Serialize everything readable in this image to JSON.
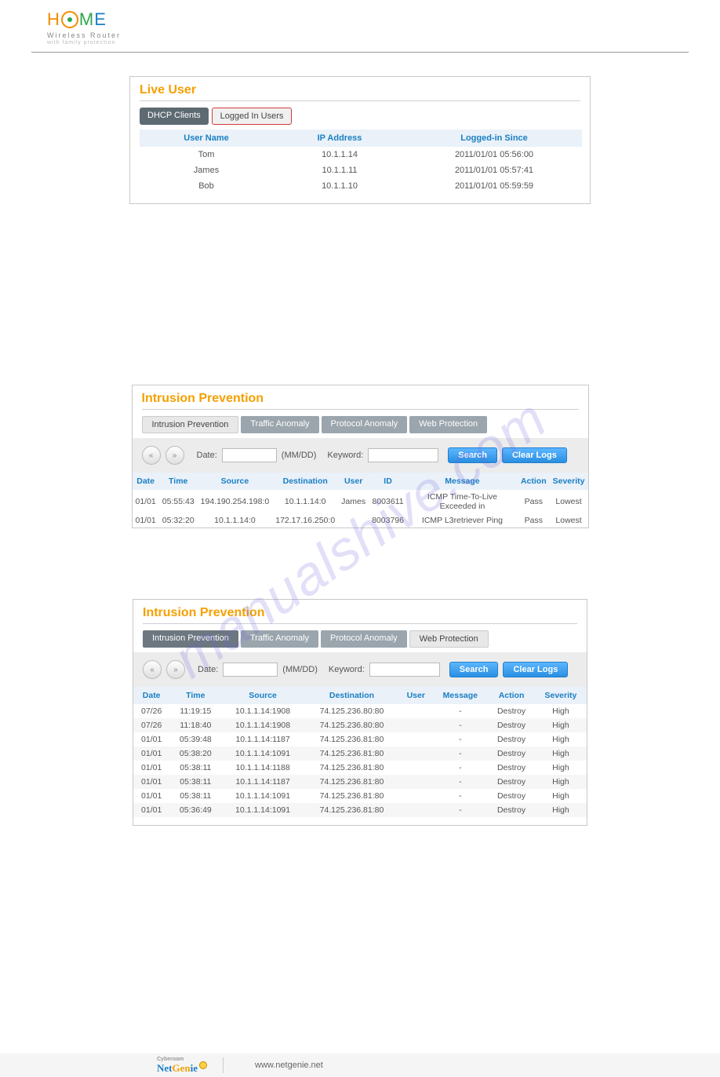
{
  "watermark": "manualshive.com",
  "logo": {
    "sub1": "Wireless  Router",
    "sub2": "with family protection"
  },
  "panel1": {
    "title": "Live User",
    "tabs": [
      "DHCP Clients",
      "Logged In Users"
    ],
    "headers": [
      "User Name",
      "IP Address",
      "Logged-in Since"
    ],
    "rows": [
      {
        "user": "Tom",
        "ip": "10.1.1.14",
        "since": "2011/01/01 05:56:00"
      },
      {
        "user": "James",
        "ip": "10.1.1.11",
        "since": "2011/01/01 05:57:41"
      },
      {
        "user": "Bob",
        "ip": "10.1.1.10",
        "since": "2011/01/01 05:59:59"
      }
    ]
  },
  "panel2": {
    "title": "Intrusion Prevention",
    "tabs": [
      "Intrusion Prevention",
      "Traffic Anomaly",
      "Protocol Anomaly",
      "Web Protection"
    ],
    "date_label": "Date:",
    "date_hint": "(MM/DD)",
    "keyword_label": "Keyword:",
    "search_btn": "Search",
    "clear_btn": "Clear Logs",
    "headers": [
      "Date",
      "Time",
      "Source",
      "Destination",
      "User",
      "ID",
      "Message",
      "Action",
      "Severity"
    ],
    "rows": [
      {
        "date": "01/01",
        "time": "05:55:43",
        "src": "194.190.254.198:0",
        "dst": "10.1.1.14:0",
        "user": "James",
        "id": "8003611",
        "msg": "ICMP Time-To-Live Exceeded in",
        "act": "Pass",
        "sev": "Lowest"
      },
      {
        "date": "01/01",
        "time": "05:32:20",
        "src": "10.1.1.14:0",
        "dst": "172.17.16.250:0",
        "user": "",
        "id": "8003796",
        "msg": "ICMP L3retriever Ping",
        "act": "Pass",
        "sev": "Lowest"
      }
    ]
  },
  "panel3": {
    "title": "Intrusion Prevention",
    "tabs": [
      "Intrusion Prevention",
      "Traffic Anomaly",
      "Protocol Anomaly",
      "Web Protection"
    ],
    "date_label": "Date:",
    "date_hint": "(MM/DD)",
    "keyword_label": "Keyword:",
    "search_btn": "Search",
    "clear_btn": "Clear Logs",
    "headers": [
      "Date",
      "Time",
      "Source",
      "Destination",
      "User",
      "Message",
      "Action",
      "Severity"
    ],
    "rows": [
      {
        "date": "07/26",
        "time": "11:19:15",
        "src": "10.1.1.14:1908",
        "dst": "74.125.236.80:80",
        "user": "",
        "msg": "-",
        "act": "Destroy",
        "sev": "High"
      },
      {
        "date": "07/26",
        "time": "11:18:40",
        "src": "10.1.1.14:1908",
        "dst": "74.125.236.80:80",
        "user": "",
        "msg": "-",
        "act": "Destroy",
        "sev": "High"
      },
      {
        "date": "01/01",
        "time": "05:39:48",
        "src": "10.1.1.14:1187",
        "dst": "74.125.236.81:80",
        "user": "",
        "msg": "-",
        "act": "Destroy",
        "sev": "High"
      },
      {
        "date": "01/01",
        "time": "05:38:20",
        "src": "10.1.1.14:1091",
        "dst": "74.125.236.81:80",
        "user": "",
        "msg": "-",
        "act": "Destroy",
        "sev": "High"
      },
      {
        "date": "01/01",
        "time": "05:38:11",
        "src": "10.1.1.14:1188",
        "dst": "74.125.236.81:80",
        "user": "",
        "msg": "-",
        "act": "Destroy",
        "sev": "High"
      },
      {
        "date": "01/01",
        "time": "05:38:11",
        "src": "10.1.1.14:1187",
        "dst": "74.125.236.81:80",
        "user": "",
        "msg": "-",
        "act": "Destroy",
        "sev": "High"
      },
      {
        "date": "01/01",
        "time": "05:38:11",
        "src": "10.1.1.14:1091",
        "dst": "74.125.236.81:80",
        "user": "",
        "msg": "-",
        "act": "Destroy",
        "sev": "High"
      },
      {
        "date": "01/01",
        "time": "05:36:49",
        "src": "10.1.1.14:1091",
        "dst": "74.125.236.81:80",
        "user": "",
        "msg": "-",
        "act": "Destroy",
        "sev": "High"
      }
    ]
  },
  "footer": {
    "brand_small": "Cyberoam",
    "link": "www.netgenie.net"
  }
}
